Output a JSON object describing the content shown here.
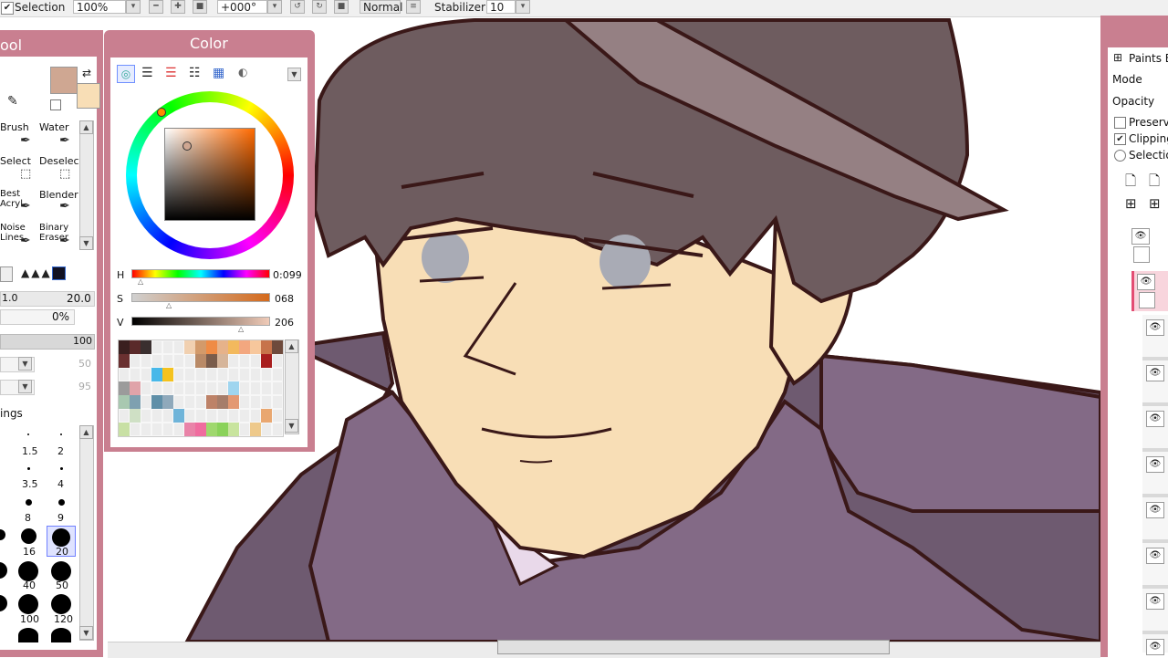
{
  "toolbar": {
    "selection_label": "Selection",
    "zoom_value": "100%",
    "rotation_value": "+000°",
    "blend_mode": "Normal",
    "stabilizer_label": "Stabilizer",
    "stabilizer_value": "10"
  },
  "tool_panel": {
    "title": "ool",
    "tools": [
      {
        "label": "Brush"
      },
      {
        "label": "Water"
      },
      {
        "label": "Select"
      },
      {
        "label": "Deselect"
      },
      {
        "label": "Best Acryl"
      },
      {
        "label": "Blender"
      },
      {
        "label": "Noise Lines"
      },
      {
        "label": "Binary Eraser"
      }
    ],
    "size_multiplier": "1.0",
    "size_value": "20.0",
    "density_value": "0%",
    "opacity_value": "100",
    "dropdown1_value": "50",
    "dropdown2_value": "95",
    "settings_label": "ings",
    "brush_sizes": [
      "1.5",
      "2",
      "3.5",
      "4",
      "8",
      "9",
      "16",
      "20",
      "40",
      "50",
      "100",
      "120"
    ],
    "selected_brush_size": "20"
  },
  "color_panel": {
    "title": "Color",
    "hsv": [
      {
        "key": "H",
        "value": "0:099"
      },
      {
        "key": "S",
        "value": "068"
      },
      {
        "key": "V",
        "value": "206"
      }
    ],
    "main_color": "#cfa792",
    "sub_color": "#f8deb6",
    "palette": [
      "#3a1f1f",
      "#5a2a2a",
      "#3a2f2f",
      "",
      "",
      "",
      "#f1d0b0",
      "#d39a6a",
      "#ef8b45",
      "#e6b28a",
      "#f3b95d",
      "#f3a77f",
      "#f7c79c",
      "#c7734a",
      "#6e4a3c",
      "#6a3030",
      "",
      "",
      "",
      "",
      "",
      "",
      "#b98a67",
      "#7a5c4b",
      "#d6b59a",
      "",
      "",
      "",
      "#a81e1e",
      "",
      "",
      "",
      "",
      "#48b8e9",
      "#f4c21e",
      "",
      "",
      "",
      "",
      "",
      "",
      "",
      "",
      "",
      "",
      "#9b9b9b",
      "#e0a3a9",
      "",
      "",
      "",
      "",
      "",
      "",
      "",
      "",
      "#9fd5ef",
      "",
      "",
      "",
      "",
      "#a8c8b0",
      "#7ea0b0",
      "",
      "#5f8fa8",
      "#8fa9bb",
      "",
      "",
      "",
      "#bd8268",
      "#a67d6a",
      "#e39872",
      "",
      "",
      "",
      "",
      "",
      "#cfe0c5",
      "",
      "",
      "",
      "#6fb4d9",
      "",
      "",
      "",
      "",
      "",
      "",
      "",
      "#e9a770",
      "",
      "#c8e0a4",
      "",
      "",
      "",
      "",
      "",
      "#e983a8",
      "#f06c9f",
      "#9fd86e",
      "#8ad25a",
      "#c8e49e",
      "",
      "#eec98b",
      "",
      ""
    ]
  },
  "layer_panel": {
    "layer_name": "Paints E",
    "mode_label": "Mode",
    "opacity_label": "Opacity",
    "preserve_label": "Preserv",
    "clipping_label": "Clipping",
    "selection_label": "Selectio"
  }
}
